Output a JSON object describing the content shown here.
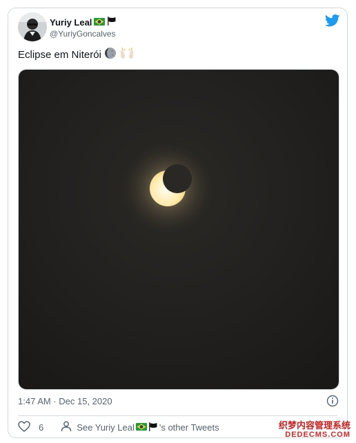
{
  "author": {
    "name": "Yuriy Leal",
    "handle": "@YuriyGoncalves",
    "name_icons": [
      "brazil-flag-icon",
      "black-flag-icon"
    ]
  },
  "tweet": {
    "text": "Eclipse em Niterói",
    "emojis": [
      "moon-phase-icon",
      "raised-hands-icon"
    ],
    "timestamp": "1:47 AM · Dec 15, 2020",
    "likes": "6"
  },
  "actions": {
    "see_other_prefix": "See Yuriy Leal",
    "see_other_suffix": "'s other Tweets"
  },
  "watermark": {
    "line1": "织梦内容管理系统",
    "line2": "DEDECMS.COM"
  },
  "colors": {
    "twitter_blue": "#1d9bf0",
    "muted_text": "#536471",
    "border": "#cfd9de"
  }
}
